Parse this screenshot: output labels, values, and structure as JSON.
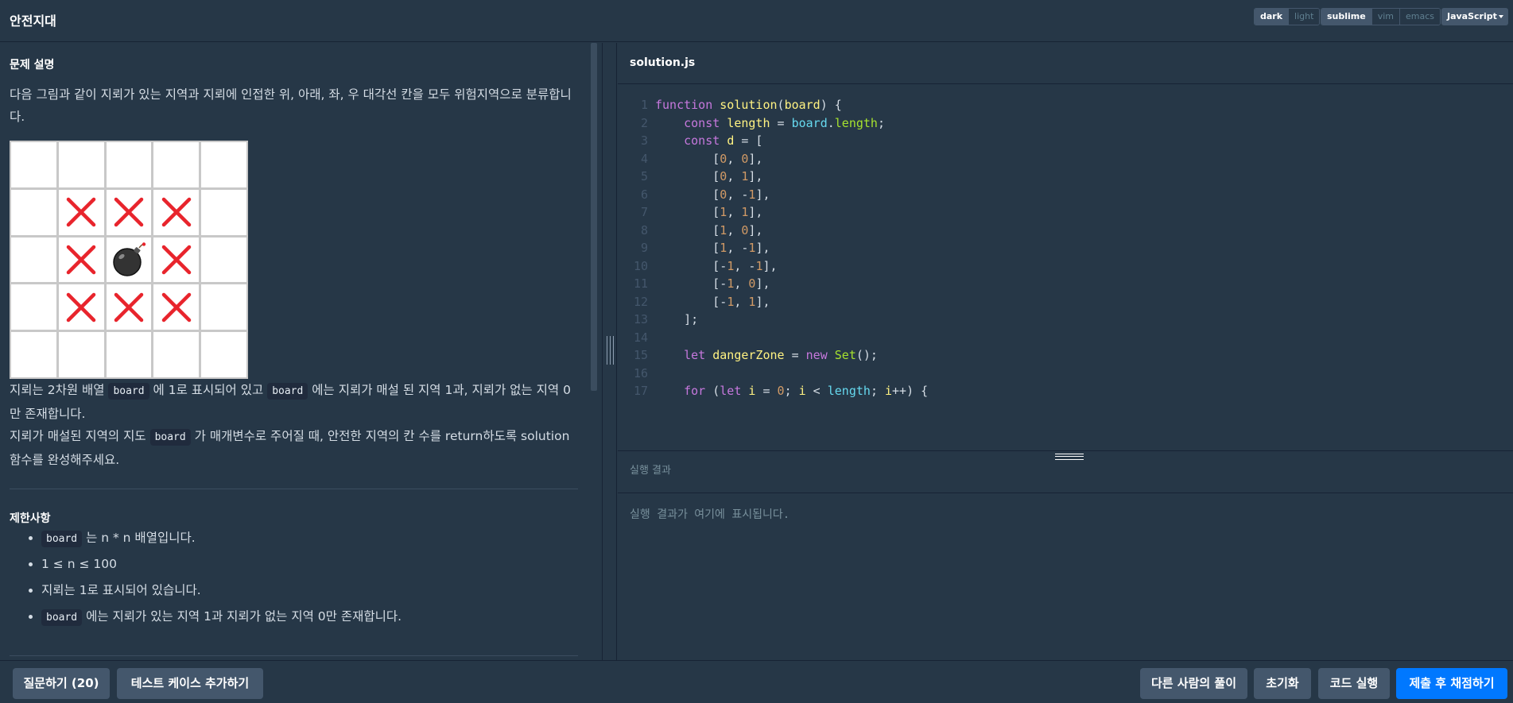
{
  "header": {
    "title": "안전지대",
    "themes": [
      "dark",
      "light"
    ],
    "active_theme": "dark",
    "keymaps": [
      "sublime",
      "vim",
      "emacs"
    ],
    "active_keymap": "sublime",
    "language": "JavaScript"
  },
  "problem": {
    "section_title": "문제 설명",
    "intro": "다음 그림과 같이 지뢰가 있는 지역과 지뢰에 인접한 위, 아래, 좌, 우 대각선 칸을 모두 위험지역으로 분류합니",
    "intro_wrap": "다.",
    "figure": {
      "grid": [
        [
          "empty",
          "empty",
          "empty",
          "empty",
          "empty"
        ],
        [
          "empty",
          "x",
          "x",
          "x",
          "empty"
        ],
        [
          "empty",
          "x",
          "bomb",
          "x",
          "empty"
        ],
        [
          "empty",
          "x",
          "x",
          "x",
          "empty"
        ],
        [
          "empty",
          "empty",
          "empty",
          "empty",
          "empty"
        ]
      ],
      "colors": {
        "mark": "#e8242c",
        "bomb": "#333333"
      }
    },
    "desc1_a": "지뢰는 2차원 배열 ",
    "desc1_code1": "board",
    "desc1_b": " 에 1로 표시되어 있고 ",
    "desc1_code2": "board",
    "desc1_c": " 에는 지뢰가 매설 된 지역 1과, 지뢰가 없는 지역 0",
    "desc1_wrap": "만 존재합니다.",
    "desc2_a": "지뢰가 매설된 지역의 지도 ",
    "desc2_code": "board",
    "desc2_b": " 가 매개변수로 주어질 때, 안전한 지역의 칸 수를 return하도록 solution",
    "desc2_wrap": "함수를 완성해주세요.",
    "constraints_title": "제한사항",
    "constraints": [
      {
        "code": "board",
        "text": " 는 n * n 배열입니다."
      },
      {
        "code": "",
        "text": "1 ≤ n ≤ 100"
      },
      {
        "code": "",
        "text": "지뢰는 1로 표시되어 있습니다."
      },
      {
        "code": "board",
        "text": " 에는 지뢰가 있는 지역 1과 지뢰가 없는 지역 0만 존재합니다."
      }
    ]
  },
  "editor": {
    "file_name": "solution.js",
    "lines": [
      [
        [
          "kw",
          "function "
        ],
        [
          "fn",
          "solution"
        ],
        [
          "pl",
          "("
        ],
        [
          "vr",
          "board"
        ],
        [
          "pl",
          ") {"
        ]
      ],
      [
        [
          "pl",
          "    "
        ],
        [
          "kw",
          "const "
        ],
        [
          "vr",
          "length"
        ],
        [
          "pl",
          " = "
        ],
        [
          "prop",
          "board"
        ],
        [
          "pl",
          "."
        ],
        [
          "cls",
          "length"
        ],
        [
          "pl",
          ";"
        ]
      ],
      [
        [
          "pl",
          "    "
        ],
        [
          "kw",
          "const "
        ],
        [
          "vr",
          "d"
        ],
        [
          "pl",
          " = ["
        ]
      ],
      [
        [
          "pl",
          "        ["
        ],
        [
          "num",
          "0"
        ],
        [
          "pl",
          ", "
        ],
        [
          "num",
          "0"
        ],
        [
          "pl",
          "],"
        ]
      ],
      [
        [
          "pl",
          "        ["
        ],
        [
          "num",
          "0"
        ],
        [
          "pl",
          ", "
        ],
        [
          "num",
          "1"
        ],
        [
          "pl",
          "],"
        ]
      ],
      [
        [
          "pl",
          "        ["
        ],
        [
          "num",
          "0"
        ],
        [
          "pl",
          ", -"
        ],
        [
          "num",
          "1"
        ],
        [
          "pl",
          "],"
        ]
      ],
      [
        [
          "pl",
          "        ["
        ],
        [
          "num",
          "1"
        ],
        [
          "pl",
          ", "
        ],
        [
          "num",
          "1"
        ],
        [
          "pl",
          "],"
        ]
      ],
      [
        [
          "pl",
          "        ["
        ],
        [
          "num",
          "1"
        ],
        [
          "pl",
          ", "
        ],
        [
          "num",
          "0"
        ],
        [
          "pl",
          "],"
        ]
      ],
      [
        [
          "pl",
          "        ["
        ],
        [
          "num",
          "1"
        ],
        [
          "pl",
          ", -"
        ],
        [
          "num",
          "1"
        ],
        [
          "pl",
          "],"
        ]
      ],
      [
        [
          "pl",
          "        [-"
        ],
        [
          "num",
          "1"
        ],
        [
          "pl",
          ", -"
        ],
        [
          "num",
          "1"
        ],
        [
          "pl",
          "],"
        ]
      ],
      [
        [
          "pl",
          "        [-"
        ],
        [
          "num",
          "1"
        ],
        [
          "pl",
          ", "
        ],
        [
          "num",
          "0"
        ],
        [
          "pl",
          "],"
        ]
      ],
      [
        [
          "pl",
          "        [-"
        ],
        [
          "num",
          "1"
        ],
        [
          "pl",
          ", "
        ],
        [
          "num",
          "1"
        ],
        [
          "pl",
          "],"
        ]
      ],
      [
        [
          "pl",
          "    ];"
        ]
      ],
      [
        [
          "pl",
          ""
        ]
      ],
      [
        [
          "pl",
          "    "
        ],
        [
          "kw",
          "let "
        ],
        [
          "vr",
          "dangerZone"
        ],
        [
          "pl",
          " = "
        ],
        [
          "kw",
          "new "
        ],
        [
          "cls",
          "Set"
        ],
        [
          "pl",
          "();"
        ]
      ],
      [
        [
          "pl",
          ""
        ]
      ],
      [
        [
          "pl",
          "    "
        ],
        [
          "kw",
          "for "
        ],
        [
          "pl",
          "("
        ],
        [
          "kw",
          "let "
        ],
        [
          "vr",
          "i"
        ],
        [
          "pl",
          " = "
        ],
        [
          "num",
          "0"
        ],
        [
          "pl",
          "; "
        ],
        [
          "vr",
          "i"
        ],
        [
          "pl",
          " < "
        ],
        [
          "prop",
          "length"
        ],
        [
          "pl",
          "; "
        ],
        [
          "vr",
          "i"
        ],
        [
          "pl",
          "++) {"
        ]
      ]
    ]
  },
  "result": {
    "title": "실행 결과",
    "placeholder": "실행 결과가 여기에 표시됩니다."
  },
  "footer": {
    "ask": "질문하기 (20)",
    "add_testcase": "테스트 케이스 추가하기",
    "others": "다른 사람의 풀이",
    "reset": "초기화",
    "run": "코드 실행",
    "submit": "제출 후 채점하기"
  }
}
